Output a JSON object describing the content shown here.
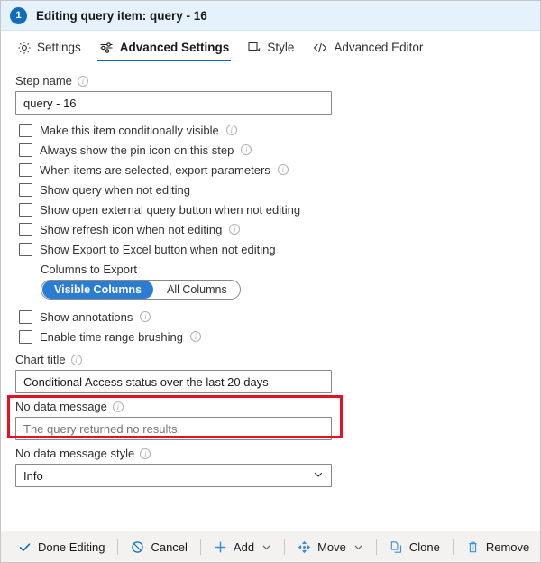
{
  "header": {
    "step_number": "1",
    "title": "Editing query item: query - 16",
    "badge_color": "#0f6cbd",
    "background": "#e5f2fb"
  },
  "tabs": [
    {
      "label": "Settings",
      "icon": "gear-icon",
      "active": false
    },
    {
      "label": "Advanced Settings",
      "icon": "sliders-icon",
      "active": true
    },
    {
      "label": "Style",
      "icon": "resize-square-icon",
      "active": false
    },
    {
      "label": "Advanced Editor",
      "icon": "code-brackets-icon",
      "active": false
    }
  ],
  "form": {
    "step_name": {
      "label": "Step name",
      "value": "query - 16",
      "has_info": true
    },
    "checkboxes": [
      {
        "label": "Make this item conditionally visible",
        "checked": false,
        "has_info": true
      },
      {
        "label": "Always show the pin icon on this step",
        "checked": false,
        "has_info": true
      },
      {
        "label": "When items are selected, export parameters",
        "checked": false,
        "has_info": true
      },
      {
        "label": "Show query when not editing",
        "checked": false,
        "has_info": false
      },
      {
        "label": "Show open external query button when not editing",
        "checked": false,
        "has_info": false
      },
      {
        "label": "Show refresh icon when not editing",
        "checked": false,
        "has_info": true
      },
      {
        "label": "Show Export to Excel button when not editing",
        "checked": false,
        "has_info": false
      }
    ],
    "columns_to_export": {
      "label": "Columns to Export",
      "options": [
        "Visible Columns",
        "All Columns"
      ],
      "selected": "Visible Columns",
      "selected_color": "#2b7cd3"
    },
    "checkboxes_after": [
      {
        "label": "Show annotations",
        "checked": false,
        "has_info": true
      },
      {
        "label": "Enable time range brushing",
        "checked": false,
        "has_info": true
      }
    ],
    "chart_title": {
      "label": "Chart title",
      "value": "Conditional Access status over the last 20 days",
      "has_info": true,
      "highlighted": true,
      "highlight_color": "#e81123"
    },
    "no_data_message": {
      "label": "No data message",
      "placeholder": "The query returned no results.",
      "value": "",
      "has_info": true
    },
    "no_data_message_style": {
      "label": "No data message style",
      "value": "Info",
      "has_info": true
    }
  },
  "toolbar": {
    "buttons": [
      {
        "label": "Done Editing",
        "icon": "checkmark-icon",
        "has_chevron": false,
        "highlighted": true
      },
      {
        "label": "Cancel",
        "icon": "cancel-circle-icon",
        "has_chevron": false,
        "highlighted": false
      },
      {
        "label": "Add",
        "icon": "plus-icon",
        "has_chevron": true,
        "highlighted": false
      },
      {
        "label": "Move",
        "icon": "move-arrows-icon",
        "has_chevron": true,
        "highlighted": false
      },
      {
        "label": "Clone",
        "icon": "copy-pages-icon",
        "has_chevron": false,
        "highlighted": false
      },
      {
        "label": "Remove",
        "icon": "trash-icon",
        "has_chevron": false,
        "highlighted": false
      }
    ],
    "accent_color": "#0f6cbd"
  }
}
